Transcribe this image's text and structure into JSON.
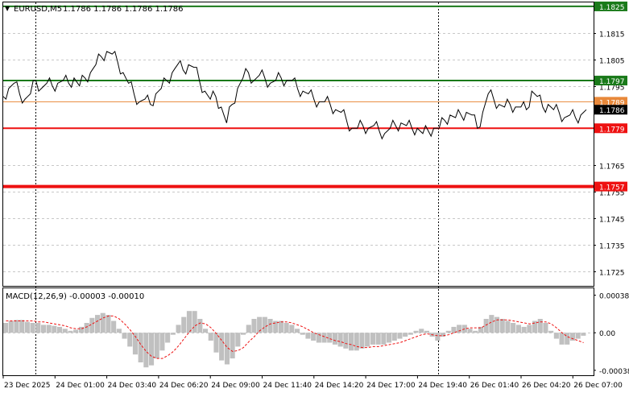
{
  "header": {
    "symbol": "EURUSD,M5",
    "ohlc": "1.1786 1.1786 1.1786 1.1786"
  },
  "colors": {
    "price_line": "#000000",
    "support_resistance_green": "#1a7a1a",
    "support_resistance_red": "#ee1111",
    "bid_line": "#e8883a",
    "macd_hist": "#c0c0c0",
    "macd_signal": "#ee1111",
    "axis_text": "#000000",
    "grid": "#c8c8c8"
  },
  "price_axis": {
    "ticks": [
      {
        "value": 1.1815,
        "label": "1.1815"
      },
      {
        "value": 1.1805,
        "label": "1.1805"
      },
      {
        "value": 1.1795,
        "label": "1.1795"
      },
      {
        "value": 1.1765,
        "label": "1.1765"
      },
      {
        "value": 1.1755,
        "label": "1.1755"
      },
      {
        "value": 1.1745,
        "label": "1.1745"
      },
      {
        "value": 1.1735,
        "label": "1.1735"
      },
      {
        "value": 1.1725,
        "label": "1.1725"
      }
    ],
    "range": [
      1.17195,
      1.18265
    ]
  },
  "levels": [
    {
      "name": "resistance-1825",
      "value": 1.1825,
      "label": "1.1825",
      "color": "#1a7a1a"
    },
    {
      "name": "resistance-1797",
      "value": 1.1797,
      "label": "1.1797",
      "color": "#1a7a1a"
    },
    {
      "name": "bid-1789",
      "value": 1.1789,
      "label": "1.1789",
      "color": "#e8883a"
    },
    {
      "name": "support-1779",
      "value": 1.1779,
      "label": "1.1779",
      "color": "#ee1111"
    },
    {
      "name": "support-1757",
      "value": 1.1757,
      "label": "1.1757",
      "color": "#ee1111"
    }
  ],
  "current_price": {
    "value": 1.1786,
    "label": "1.1786"
  },
  "time_axis": {
    "labels": [
      "23 Dec 2025",
      "24 Dec 01:00",
      "24 Dec 03:40",
      "24 Dec 06:20",
      "24 Dec 09:00",
      "24 Dec 11:40",
      "24 Dec 14:20",
      "24 Dec 17:00",
      "24 Dec 19:40",
      "26 Dec 01:40",
      "26 Dec 04:20",
      "26 Dec 07:00"
    ]
  },
  "macd": {
    "title": "MACD(12,26,9) -0.00003 -0.00010",
    "ticks": [
      {
        "value": 0.00038,
        "label": "0.00038"
      },
      {
        "value": 0.0,
        "label": "0.00"
      },
      {
        "value": -0.00038,
        "label": "-0.00038"
      }
    ],
    "range": [
      -0.00043,
      0.00045
    ]
  },
  "chart_data": {
    "type": "line",
    "title": "EURUSD,M5",
    "series": [
      {
        "name": "EURUSD",
        "values": [
          1.1791,
          1.1794,
          1.1796,
          1.1792,
          1.179,
          1.1792,
          1.1797,
          1.1794,
          1.1796,
          1.1795,
          1.1796,
          1.1797,
          1.1796,
          1.1798,
          1.1795,
          1.1798,
          1.18,
          1.1803,
          1.1806,
          1.1808,
          1.1807,
          1.1804,
          1.18,
          1.1796,
          1.1792,
          1.1789,
          1.179,
          1.1788,
          1.1792,
          1.1794,
          1.1797,
          1.18,
          1.1803,
          1.1801,
          1.1803,
          1.1802,
          1.1797,
          1.1793,
          1.179,
          1.1791,
          1.1787,
          1.1781,
          1.1788,
          1.1794,
          1.1798,
          1.18,
          1.1797,
          1.1799,
          1.1798,
          1.1796,
          1.1797,
          1.1798,
          1.1797,
          1.1797,
          1.1794,
          1.1793,
          1.1792,
          1.179,
          1.1789,
          1.1789,
          1.1788,
          1.1786,
          1.1785,
          1.1782,
          1.1779,
          1.1779,
          1.178,
          1.1779,
          1.178,
          1.1778,
          1.1777,
          1.1779,
          1.178,
          1.1781,
          1.178,
          1.1779,
          1.1779,
          1.1777,
          1.1778,
          1.1779,
          1.1779,
          1.1782,
          1.1784,
          1.1783,
          1.1784,
          1.1785,
          1.1784,
          1.1779,
          1.1785,
          1.1792,
          1.179,
          1.1788,
          1.1787,
          1.1788,
          1.1787,
          1.1787,
          1.1786,
          1.1793,
          1.1791,
          1.1787,
          1.1788,
          1.1786,
          1.1785,
          1.1783,
          1.1784,
          1.1783,
          1.1784,
          1.1786
        ]
      }
    ],
    "macd_histogram": [
      0.0001,
      0.00012,
      0.00013,
      0.00013,
      0.00011,
      0.0001,
      0.0001,
      8e-05,
      8e-05,
      7e-05,
      6e-05,
      4e-05,
      2e-05,
      3e-05,
      6e-05,
      0.0001,
      0.00015,
      0.00018,
      0.0002,
      0.00018,
      0.00012,
      4e-05,
      -6e-05,
      -0.00014,
      -0.00022,
      -0.0003,
      -0.00035,
      -0.00033,
      -0.00026,
      -0.00018,
      -0.0001,
      -2e-05,
      8e-05,
      0.00016,
      0.00022,
      0.00022,
      0.00014,
      4e-05,
      -8e-05,
      -0.0002,
      -0.00028,
      -0.00032,
      -0.00026,
      -0.00014,
      -2e-05,
      8e-05,
      0.00014,
      0.00016,
      0.00016,
      0.00014,
      0.00012,
      0.00012,
      0.0001,
      8e-05,
      4e-05,
      -2e-05,
      -6e-05,
      -8e-05,
      -0.0001,
      -0.0001,
      -0.0001,
      -0.00012,
      -0.00014,
      -0.00016,
      -0.00018,
      -0.00018,
      -0.00016,
      -0.00014,
      -0.00012,
      -0.00012,
      -0.00012,
      -0.0001,
      -8e-05,
      -6e-05,
      -4e-05,
      -2e-05,
      2e-05,
      4e-05,
      2e-05,
      -4e-05,
      -8e-05,
      -4e-05,
      2e-05,
      6e-05,
      8e-05,
      8e-05,
      4e-05,
      2e-05,
      6e-05,
      0.00014,
      0.00018,
      0.00016,
      0.00014,
      0.00012,
      0.0001,
      8e-05,
      6e-05,
      8e-05,
      0.00012,
      0.00014,
      0.0001,
      2e-05,
      -6e-05,
      -0.00012,
      -0.00012,
      -8e-05,
      -6e-05,
      -3e-05
    ],
    "macd_signal": [
      0.00012,
      0.00012,
      0.00012,
      0.00012,
      0.00012,
      0.00012,
      0.00011,
      0.00011,
      0.0001,
      9e-05,
      8e-05,
      7e-05,
      5e-05,
      4e-05,
      4e-05,
      6e-05,
      9e-05,
      0.00012,
      0.00015,
      0.00017,
      0.00017,
      0.00014,
      9e-05,
      3e-05,
      -4e-05,
      -0.00012,
      -0.00019,
      -0.00024,
      -0.00026,
      -0.00026,
      -0.00023,
      -0.00019,
      -0.00013,
      -6e-05,
      1e-05,
      7e-05,
      0.0001,
      9e-05,
      5e-05,
      -1e-05,
      -8e-05,
      -0.00015,
      -0.00019,
      -0.00018,
      -0.00015,
      -9e-05,
      -4e-05,
      2e-05,
      6e-05,
      9e-05,
      0.0001,
      0.00011,
      0.00011,
      0.0001,
      8e-05,
      6e-05,
      3e-05,
      0.0,
      -2e-05,
      -4e-05,
      -6e-05,
      -8e-05,
      -9e-05,
      -0.00011,
      -0.00012,
      -0.00014,
      -0.00015,
      -0.00015,
      -0.00014,
      -0.00014,
      -0.00013,
      -0.00012,
      -0.00011,
      -0.0001,
      -8e-05,
      -6e-05,
      -4e-05,
      -2e-05,
      -1e-05,
      -2e-05,
      -3e-05,
      -3e-05,
      -2e-05,
      0.0,
      2e-05,
      4e-05,
      5e-05,
      5e-05,
      5e-05,
      8e-05,
      0.00011,
      0.00013,
      0.00013,
      0.00013,
      0.00012,
      0.00011,
      0.0001,
      9e-05,
      0.0001,
      0.00011,
      0.00011,
      9e-05,
      5e-05,
      0.0,
      -4e-05,
      -6e-05,
      -8e-05,
      -0.0001
    ]
  }
}
